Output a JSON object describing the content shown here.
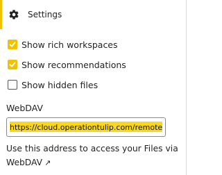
{
  "header": {
    "settings_label": "Settings",
    "icon": "gear-icon"
  },
  "options": [
    {
      "label": "Show rich workspaces",
      "checked": true
    },
    {
      "label": "Show recommendations",
      "checked": true
    },
    {
      "label": "Show hidden files",
      "checked": false
    }
  ],
  "webdav": {
    "title": "WebDAV",
    "url": "https://cloud.operationtulip.com/remote.php/dav/files/",
    "help_text": "Use this address to access your Files via",
    "help_link_text": "WebDAV",
    "link_icon": "external-link-icon"
  },
  "colors": {
    "accent": "#f2c200",
    "highlight": "#f7d722",
    "text": "#222222"
  }
}
